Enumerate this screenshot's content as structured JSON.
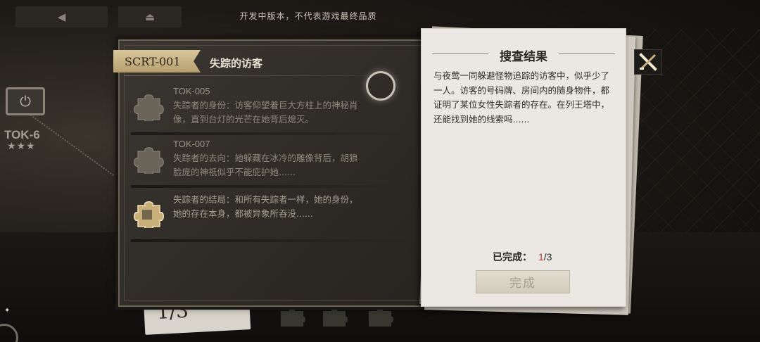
{
  "topbar": {
    "back_icon": "back-triangle-icon",
    "home_icon": "home-eject-icon",
    "dev_notice": "开发中版本，不代表游戏最终品质"
  },
  "scene": {
    "node_label": "TOK-6",
    "node_stars": "★★★",
    "bottom_card_text": "1/3"
  },
  "clue_panel": {
    "code": "SCRT-001",
    "title": "失踪的访客",
    "clues": [
      {
        "id": "TOK-005",
        "text": "失踪者的身份：访客仰望着巨大方柱上的神秘肖像，直到台灯的光芒在她背后熄灭。",
        "state": "locked"
      },
      {
        "id": "TOK-007",
        "text": "失踪者的去向：她躲藏在冰冷的雕像背后，胡狼脸庞的神祇似乎不能庇护她......",
        "state": "locked"
      },
      {
        "id": "",
        "text": "失踪者的结局：和所有失踪者一样，她的身份，她的存在本身，都被异象所吞没......",
        "state": "unlocked"
      }
    ]
  },
  "result_sheet": {
    "title": "搜查结果",
    "body": "与夜莺一同躲避怪物追踪的访客中，似乎少了一人。访客的号码牌、房间内的随身物件，都证明了某位女性失踪者的存在。在列王塔中，还能找到她的线索吗......",
    "progress_label": "已完成：",
    "progress_current": "1",
    "progress_total": "/3",
    "complete_button": "完成"
  },
  "colors": {
    "accent_gold": "#c9b07a",
    "progress_red": "#b3372f",
    "sheet_paper": "#ebe8e3"
  }
}
